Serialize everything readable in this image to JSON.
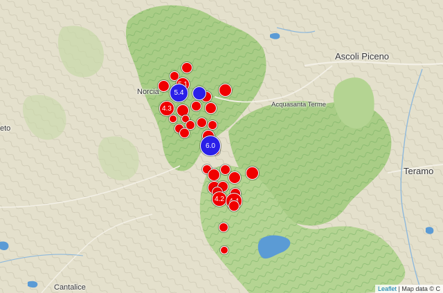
{
  "places": [
    {
      "key": "ascoli",
      "label": "Ascoli Piceno"
    },
    {
      "key": "acquasanta",
      "label": "Acquasanta Terme"
    },
    {
      "key": "norcia",
      "label": "Norcia"
    },
    {
      "key": "teramo",
      "label": "Teramo"
    },
    {
      "key": "cantalice",
      "label": "Cantalice"
    },
    {
      "key": "rieti",
      "label": "eto"
    }
  ],
  "earthquakes": [
    {
      "magnitude": "5.1",
      "color": "red"
    },
    {
      "magnitude": "5.4",
      "color": "blue"
    },
    {
      "magnitude": "",
      "color": "blue"
    },
    {
      "magnitude": "4.3",
      "color": "red"
    },
    {
      "magnitude": "6.0",
      "color": "blue"
    },
    {
      "magnitude": "4.2",
      "color": "red"
    },
    {
      "magnitude": "4.4",
      "color": "red"
    },
    {
      "magnitude": "",
      "color": "red"
    }
  ],
  "attribution": {
    "leaflet": "Leaflet",
    "text": "Map data © C"
  },
  "colors": {
    "quake_red": "#f00000",
    "quake_blue": "#2a1fe8",
    "lake": "#5b9bd5"
  }
}
